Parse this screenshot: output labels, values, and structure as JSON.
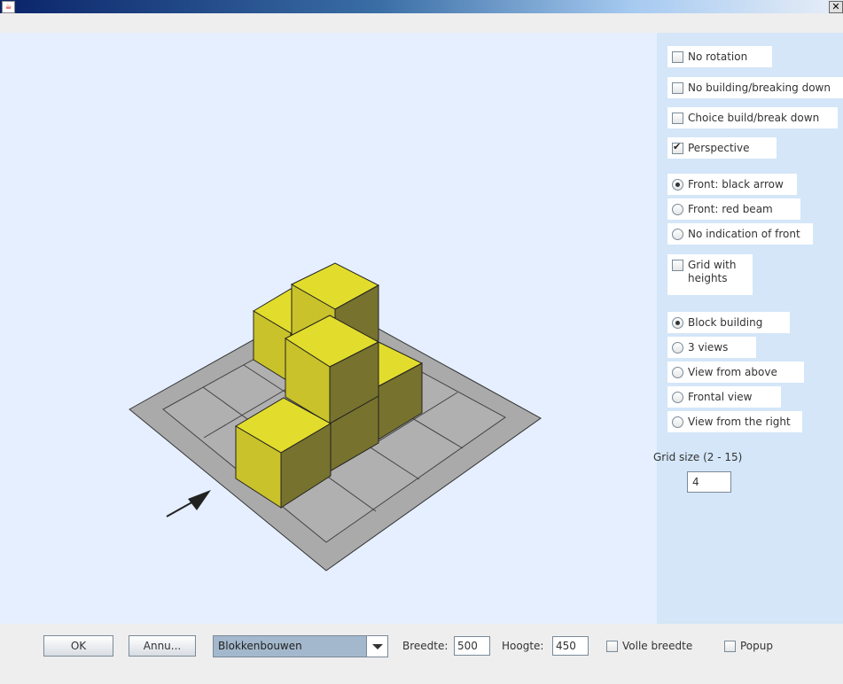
{
  "window": {
    "app_icon": "java-icon",
    "close_label": "✕"
  },
  "options": {
    "no_rotation": "No rotation",
    "no_building": "No building/breaking down",
    "choice_build": "Choice build/break down",
    "perspective": "Perspective",
    "front_black_arrow": "Front: black arrow",
    "front_red_beam": "Front: red beam",
    "no_indication": "No indication of front",
    "grid_heights_1": "Grid with",
    "grid_heights_2": "heights",
    "block_building": "Block building",
    "three_views": "3 views",
    "view_above": "View from above",
    "frontal_view": "Frontal view",
    "view_right": "View from the right",
    "grid_size_label": "Grid size (2 - 15)",
    "grid_size_value": "4"
  },
  "states": {
    "no_rotation": false,
    "no_building": false,
    "choice_build": false,
    "perspective": true,
    "front": "black arrow",
    "grid_heights": false,
    "view": "Block building"
  },
  "bottom": {
    "ok": "OK",
    "cancel": "Annu...",
    "mode_select": "Blokkenbouwen",
    "width_label": "Breedte:",
    "width_value": "500",
    "height_label": "Hoogte:",
    "height_value": "450",
    "full_width": "Volle breedte",
    "popup": "Popup"
  },
  "colors": {
    "canvas_bg": "#e5efff",
    "side_bg": "#d4e6f8",
    "cube_top": "#e2dd2c",
    "cube_left": "#c9c22a",
    "cube_right": "#77722e",
    "board": "#aaaaaa"
  }
}
